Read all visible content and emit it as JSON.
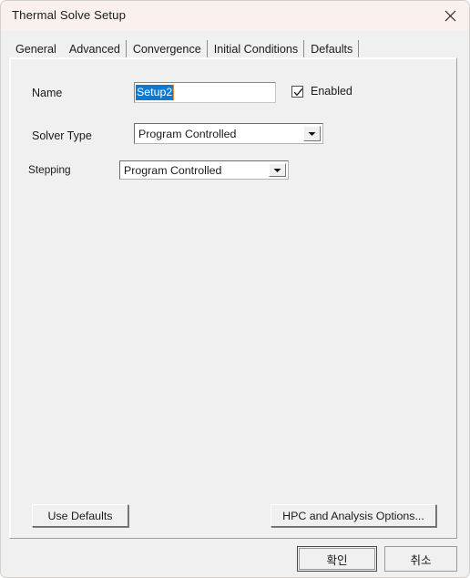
{
  "window": {
    "title": "Thermal Solve Setup",
    "close_icon": "close-icon"
  },
  "tabs": [
    {
      "label": "General",
      "selected": true
    },
    {
      "label": "Advanced",
      "selected": false
    },
    {
      "label": "Convergence",
      "selected": false
    },
    {
      "label": "Initial Conditions",
      "selected": false
    },
    {
      "label": "Defaults",
      "selected": false
    }
  ],
  "form": {
    "name": {
      "label": "Name",
      "value": "Setup2",
      "placeholder": ""
    },
    "enabled": {
      "label": "Enabled",
      "checked": true
    },
    "solver_type": {
      "label": "Solver Type",
      "value": "Program Controlled"
    },
    "stepping": {
      "label": "Stepping",
      "value": "Program Controlled"
    }
  },
  "panel_buttons": {
    "use_defaults": "Use Defaults",
    "hpc_options": "HPC and Analysis Options..."
  },
  "footer": {
    "ok": "확인",
    "cancel": "취소"
  },
  "colors": {
    "titlebar_bg": "#faf0ee",
    "dialog_bg": "#f0f0f0",
    "selection_bg": "#0a7ad4",
    "caret": "#e8884a",
    "text": "#1a1a1a",
    "border": "#a0a0a0"
  }
}
